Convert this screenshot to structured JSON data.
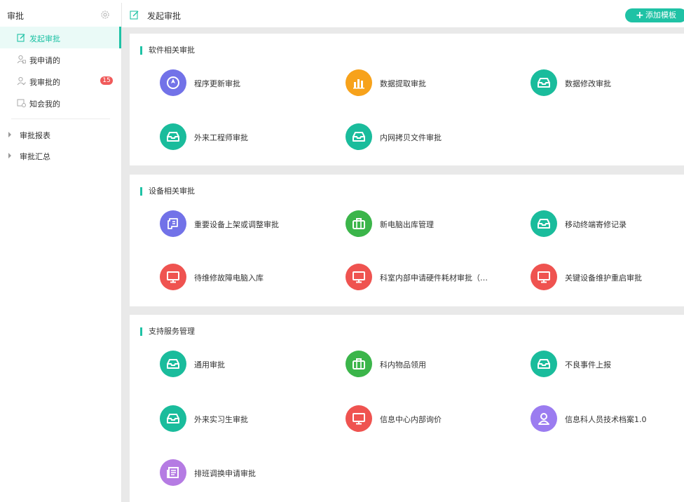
{
  "sidebar": {
    "title": "审批",
    "settings_icon": "gear-icon",
    "items": [
      {
        "label": "发起审批",
        "icon": "edit-icon",
        "active": true
      },
      {
        "label": "我申请的",
        "icon": "user-icon"
      },
      {
        "label": "我审批的",
        "icon": "user-check-icon",
        "badge": "15"
      },
      {
        "label": "知会我的",
        "icon": "notify-icon"
      }
    ],
    "groups": [
      {
        "label": "审批报表"
      },
      {
        "label": "审批汇总"
      }
    ]
  },
  "header": {
    "title": "发起审批",
    "add_button": {
      "plus": "+",
      "label": "添加模板"
    }
  },
  "colors": {
    "accent": "#1fc2a5",
    "teal": "#1abc9c",
    "orange": "#f7a21b",
    "purple": "#7272e8",
    "green": "#3bb54a",
    "red": "#ef5350",
    "violet": "#b57be3",
    "lavender": "#9b7cf0",
    "badge": "#f05a5a"
  },
  "sections": [
    {
      "title": "软件相关审批",
      "items": [
        {
          "label": "程序更新审批",
          "icon": "compass-icon",
          "color": "#7272e8"
        },
        {
          "label": "数据提取审批",
          "icon": "bar-chart-icon",
          "color": "#f7a21b"
        },
        {
          "label": "数据修改审批",
          "icon": "inbox-icon",
          "color": "#1abc9c"
        },
        {
          "label": "外来工程师审批",
          "icon": "inbox-icon",
          "color": "#1abc9c"
        },
        {
          "label": "内网拷贝文件审批",
          "icon": "inbox-icon",
          "color": "#1abc9c"
        }
      ]
    },
    {
      "title": "设备相关审批",
      "items": [
        {
          "label": "重要设备上架或调整审批",
          "icon": "scroll-icon",
          "color": "#7272e8"
        },
        {
          "label": "新电脑出库管理",
          "icon": "briefcase-icon",
          "color": "#3bb54a"
        },
        {
          "label": "移动终端寄修记录",
          "icon": "inbox-icon",
          "color": "#1abc9c"
        },
        {
          "label": "待维修故障电脑入库",
          "icon": "monitor-icon",
          "color": "#ef5350"
        },
        {
          "label": "科室内部申请硬件耗材审批（…",
          "icon": "monitor-icon",
          "color": "#ef5350"
        },
        {
          "label": "关键设备维护重启审批",
          "icon": "monitor-icon",
          "color": "#ef5350"
        }
      ]
    },
    {
      "title": "支持服务管理",
      "items": [
        {
          "label": "通用审批",
          "icon": "inbox-icon",
          "color": "#1abc9c"
        },
        {
          "label": "科内物品领用",
          "icon": "briefcase-icon",
          "color": "#3bb54a"
        },
        {
          "label": "不良事件上报",
          "icon": "inbox-icon",
          "color": "#1abc9c"
        },
        {
          "label": "外来实习生审批",
          "icon": "inbox-icon",
          "color": "#1abc9c"
        },
        {
          "label": "信息中心内部询价",
          "icon": "monitor-icon",
          "color": "#ef5350"
        },
        {
          "label": "信息科人员技术档案1.0",
          "icon": "person-icon",
          "color": "#9b7cf0"
        },
        {
          "label": "排班调换申请审批",
          "icon": "newspaper-icon",
          "color": "#b57be3"
        }
      ]
    }
  ]
}
